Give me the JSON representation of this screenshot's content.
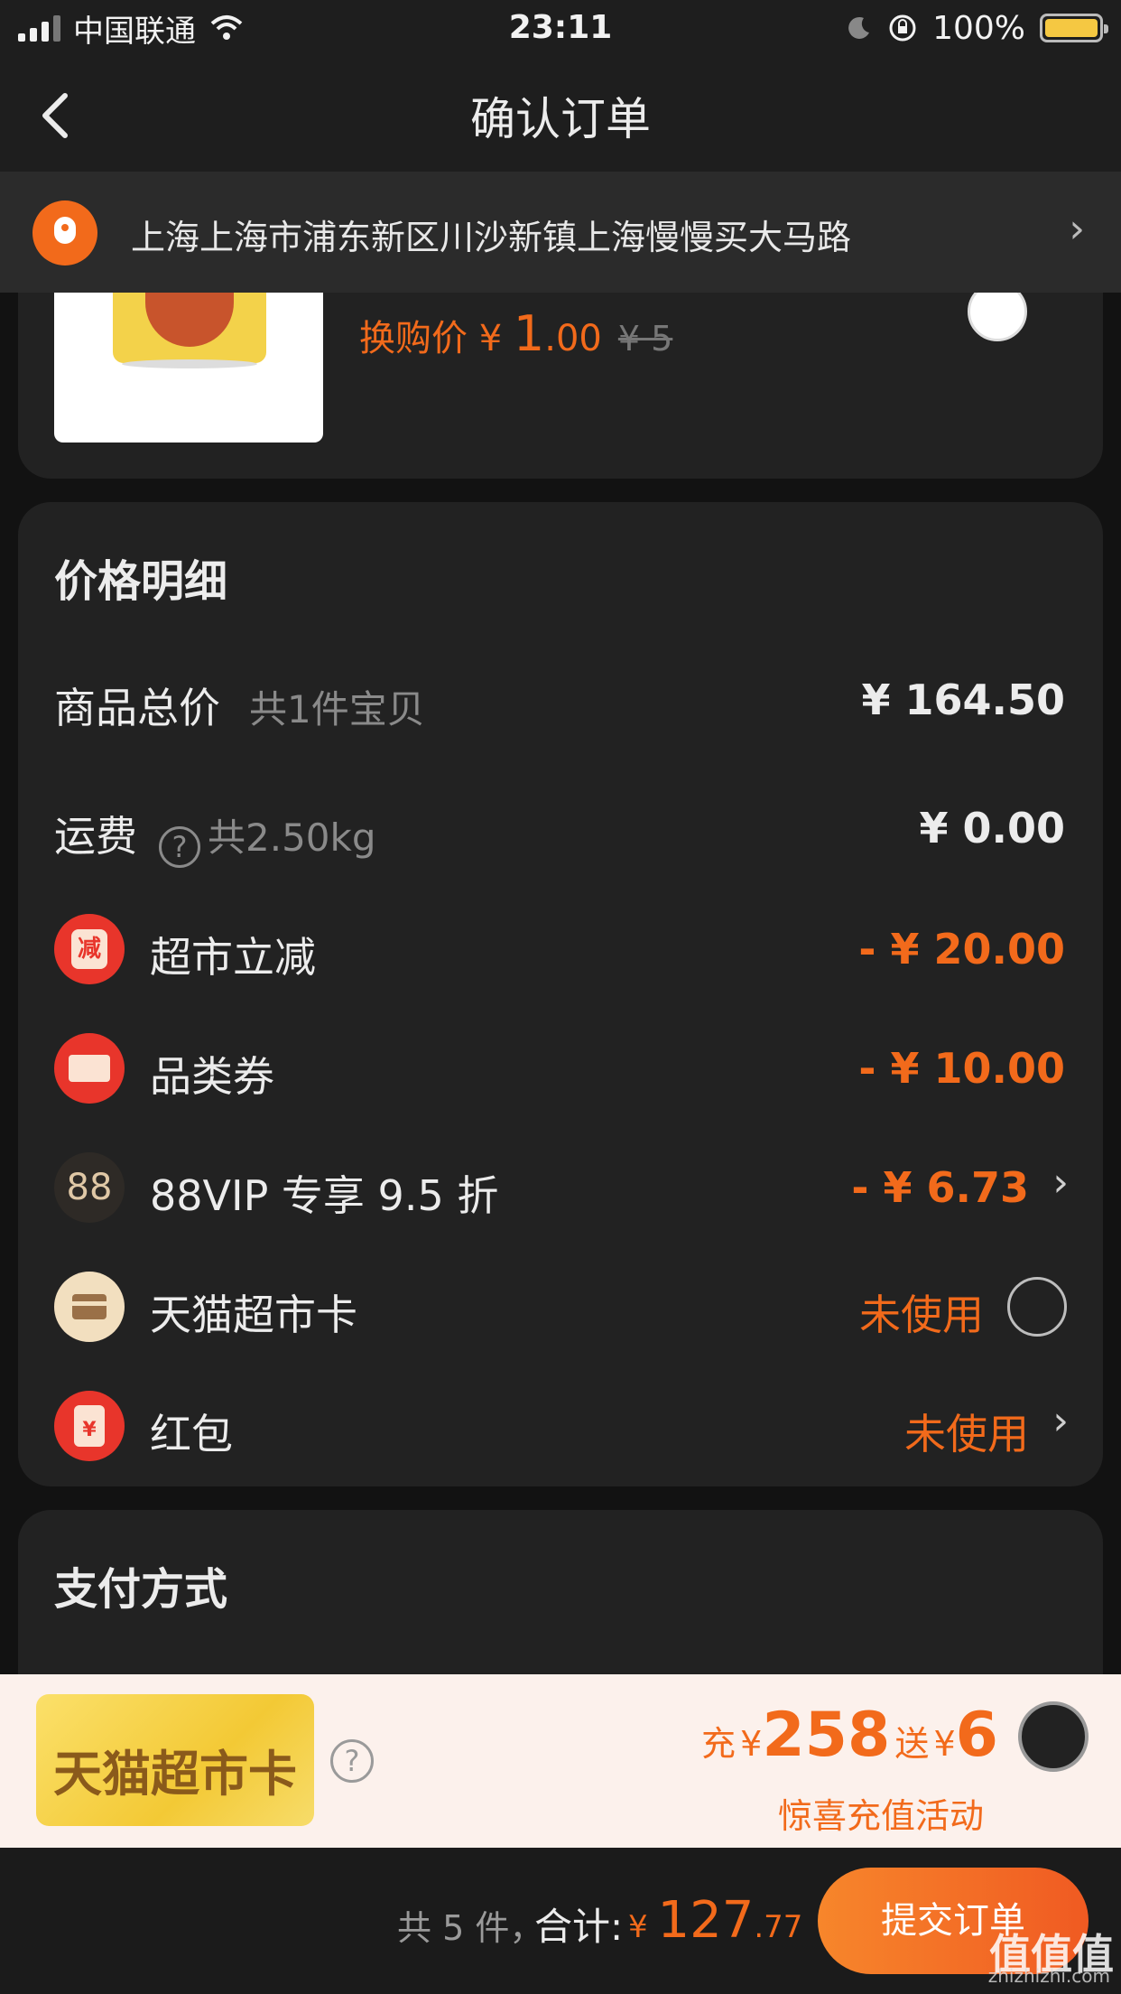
{
  "status_bar": {
    "carrier": "中国联通",
    "time": "23:11",
    "battery": "100%"
  },
  "nav": {
    "back_icon": "chevron-left-icon",
    "title": "确认订单"
  },
  "address": {
    "text": "上海上海市浦东新区川沙新镇上海慢慢买大马路",
    "arrow": "›"
  },
  "product": {
    "swap_label": "换购价 ¥ ",
    "swap_int": "1",
    "swap_dec": ".00",
    "original": "¥ 5"
  },
  "price_detail": {
    "title": "价格明细",
    "goods_label": "商品总价",
    "goods_sub": "共1件宝贝",
    "goods_value": "¥ 164.50",
    "shipping_label": "运费",
    "shipping_help": "?",
    "shipping_sub": "共2.50kg",
    "shipping_value": "¥ 0.00",
    "discount_icon_text": "减",
    "discount_label": "超市立减",
    "discount_value": "- ¥ 20.00",
    "coupon_label": "品类券",
    "coupon_value": "- ¥ 10.00",
    "vip_icon_text": "88",
    "vip_label": "88VIP 专享 9.5 折",
    "vip_value": "- ¥ 6.73",
    "card_label": "天猫超市卡",
    "card_value": "未使用",
    "hongbao_icon_text": "¥",
    "hongbao_label": "红包",
    "hongbao_value": "未使用",
    "chevron": "›"
  },
  "payment": {
    "title": "支付方式"
  },
  "promo": {
    "badge": "天猫超市卡",
    "help": "?",
    "prefix": "充",
    "yen": "¥",
    "amount": "258",
    "give": "送",
    "bonus": "6",
    "subtitle": "惊喜充值活动"
  },
  "bottom": {
    "count": "共 5 件，",
    "total_label": "合计:",
    "yen": "¥ ",
    "total_int": "127",
    "total_dec": ".77",
    "submit": "提交订单",
    "watermark": "值值值",
    "watermark_url": "zhizhizhi.com"
  },
  "colors": {
    "accent": "#f26a1b",
    "background": "#121212",
    "card": "#222222"
  }
}
